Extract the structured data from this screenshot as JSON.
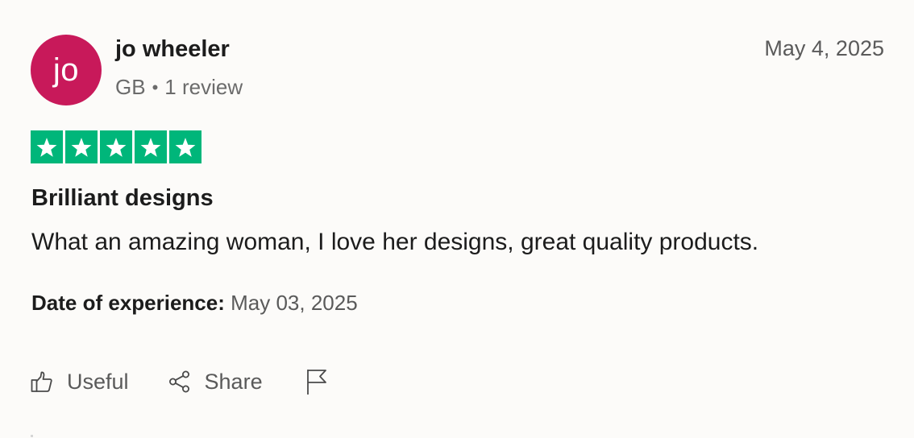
{
  "reviewer": {
    "initials": "jo",
    "name": "jo wheeler",
    "country": "GB",
    "separator": "•",
    "review_count": "1 review",
    "avatar_color": "#c8195a"
  },
  "review": {
    "date": "May 4, 2025",
    "rating": 5,
    "rating_max": 5,
    "star_color": "#00b67a",
    "title": "Brilliant designs",
    "text": "What an amazing woman, I love her designs, great quality products.",
    "experience_label": "Date of experience:",
    "experience_date": "May 03, 2025"
  },
  "actions": {
    "useful_label": "Useful",
    "useful_icon": "thumbs-up-icon",
    "share_label": "Share",
    "share_icon": "share-icon",
    "report_icon": "flag-icon"
  }
}
